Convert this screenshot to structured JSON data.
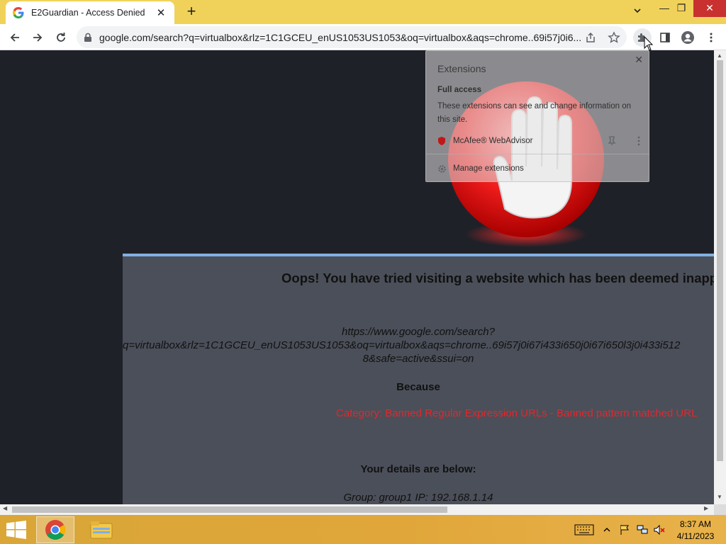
{
  "browser": {
    "tab": {
      "title": "E2Guardian - Access Denied",
      "close_label": "✕"
    },
    "new_tab_label": "+",
    "window_controls": {
      "minimize": "—",
      "restore": "❐",
      "close": "✕"
    },
    "url": "google.com/search?q=virtualbox&rlz=1C1GCEU_enUS1053US1053&oq=virtualbox&aqs=chrome..69i57j0i6..."
  },
  "page": {
    "headline": "Oops! You have tried visiting a website which has been deemed inappropriate",
    "blocked_url": {
      "line1": "https://www.google.com/search?",
      "line2": "q=virtualbox&rlz=1C1GCEU_enUS1053US1053&oq=virtualbox&aqs=chrome..69i57j0i67i433i650j0i67i650l3j0i433i512",
      "line3": "8&safe=active&ssui=on"
    },
    "because_label": "Because",
    "category": "Category: Banned Regular Expression URLs - Banned pattern matched URL",
    "details_label": "Your details are below:",
    "group_line": "Group: group1   IP: 192.168.1.14"
  },
  "extensions_popup": {
    "title": "Extensions",
    "close_label": "✕",
    "section": "Full access",
    "description": "These extensions can see and change information on this site.",
    "items": [
      {
        "name": "McAfee® WebAdvisor"
      }
    ],
    "manage_label": "Manage extensions"
  },
  "taskbar": {
    "time": "8:37 AM",
    "date": "4/11/2023"
  },
  "colors": {
    "titlebar": "#f0d25a",
    "panel": "#4b4f59",
    "category_red": "#e4262b",
    "taskbar": "#e0a63a"
  }
}
